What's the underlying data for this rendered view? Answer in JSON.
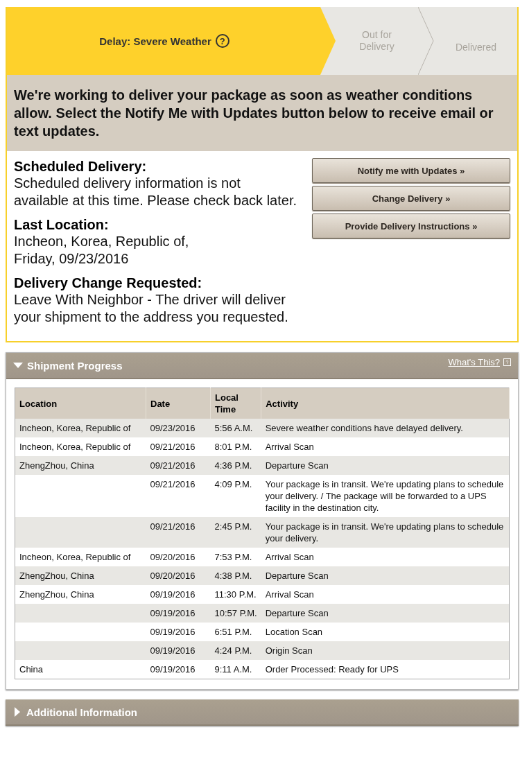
{
  "progress": {
    "steps": [
      {
        "label": "Delay: Severe Weather",
        "active": true,
        "help": "?"
      },
      {
        "label": "Out for Delivery",
        "active": false
      },
      {
        "label": "Delivered",
        "active": false
      }
    ]
  },
  "message": "We're working to deliver your package as soon as weather conditions allow. Select the Notify Me with Updates button below to receive email or text updates.",
  "details": [
    {
      "heading": "Scheduled Delivery:",
      "text": "Scheduled delivery information is not available at this time. Please check back later."
    },
    {
      "heading": "Last Location:",
      "lines": [
        "Incheon, Korea, Republic of,",
        "Friday, 09/23/2016"
      ]
    },
    {
      "heading": "Delivery Change Requested:",
      "text": "Leave With Neighbor - The driver will deliver your shipment to the address you requested."
    }
  ],
  "buttons": [
    "Notify me with Updates »",
    "Change Delivery »",
    "Provide Delivery Instructions »"
  ],
  "shipment_progress": {
    "title": "Shipment Progress",
    "expanded": true,
    "help_link": "What's This?",
    "help_icon": "?",
    "columns": [
      "Location",
      "Date",
      "Local Time",
      "Activity"
    ],
    "rows": [
      [
        "Incheon, Korea, Republic of",
        "09/23/2016",
        "5:56 A.M.",
        "Severe weather conditions have delayed delivery."
      ],
      [
        "Incheon, Korea, Republic of",
        "09/21/2016",
        "8:01 P.M.",
        "Arrival Scan"
      ],
      [
        "ZhengZhou, China",
        "09/21/2016",
        "4:36 P.M.",
        "Departure Scan"
      ],
      [
        "",
        "09/21/2016",
        "4:09 P.M.",
        "Your package is in transit. We're updating plans to schedule your delivery. / The package will be forwarded to a UPS facility in the destination city."
      ],
      [
        "",
        "09/21/2016",
        "2:45 P.M.",
        "Your package is in transit. We're updating plans to schedule your delivery."
      ],
      [
        "Incheon, Korea, Republic of",
        "09/20/2016",
        "7:53 P.M.",
        "Arrival Scan"
      ],
      [
        "ZhengZhou, China",
        "09/20/2016",
        "4:38 P.M.",
        "Departure Scan"
      ],
      [
        "ZhengZhou, China",
        "09/19/2016",
        "11:30 P.M.",
        "Arrival Scan"
      ],
      [
        "",
        "09/19/2016",
        "10:57 P.M.",
        "Departure Scan"
      ],
      [
        "",
        "09/19/2016",
        "6:51 P.M.",
        "Location Scan"
      ],
      [
        "",
        "09/19/2016",
        "4:24 P.M.",
        "Origin Scan"
      ],
      [
        "China",
        "09/19/2016",
        "9:11 A.M.",
        "Order Processed: Ready for UPS"
      ]
    ]
  },
  "additional_information": {
    "title": "Additional Information",
    "expanded": false
  }
}
